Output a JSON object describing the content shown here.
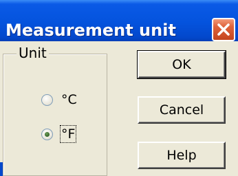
{
  "window": {
    "title": "Measurement unit",
    "close_icon": "close-x-icon"
  },
  "group": {
    "label": "Unit",
    "options": [
      {
        "label": "°C",
        "selected": false
      },
      {
        "label": "°F",
        "selected": true
      }
    ]
  },
  "buttons": {
    "ok": "OK",
    "cancel": "Cancel",
    "help": "Help"
  },
  "colors": {
    "titlebar": "#0453dd",
    "dialog_bg": "#ece9d8",
    "close_button": "#e0643c"
  }
}
